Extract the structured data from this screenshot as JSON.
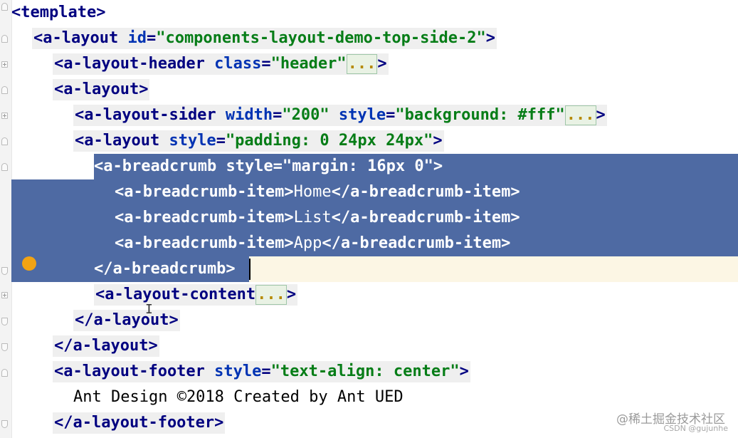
{
  "editor": {
    "lines": [
      {
        "parts": [
          [
            "tag",
            "<template"
          ],
          [
            "tag",
            ">"
          ]
        ]
      },
      {
        "parts": [
          [
            "tag",
            "<a-layout "
          ],
          [
            "attr",
            "id"
          ],
          [
            "tag",
            "="
          ],
          [
            "val",
            "\"components-layout-demo-top-side-2\""
          ],
          [
            "tag",
            ">"
          ]
        ]
      },
      {
        "parts": [
          [
            "tag",
            "<a-layout-header "
          ],
          [
            "attr",
            "class"
          ],
          [
            "tag",
            "="
          ],
          [
            "val",
            "\"header\""
          ],
          [
            "dots",
            "..."
          ],
          [
            "tag",
            ">"
          ]
        ]
      },
      {
        "parts": [
          [
            "tag",
            "<a-layout>"
          ]
        ]
      },
      {
        "parts": [
          [
            "tag",
            "<a-layout-sider "
          ],
          [
            "attr",
            "width"
          ],
          [
            "tag",
            "="
          ],
          [
            "val",
            "\"200\" "
          ],
          [
            "attr",
            "style"
          ],
          [
            "tag",
            "="
          ],
          [
            "val",
            "\"background: #fff\""
          ],
          [
            "dots",
            "..."
          ],
          [
            "tag",
            ">"
          ]
        ]
      },
      {
        "parts": [
          [
            "tag",
            "<a-layout "
          ],
          [
            "attr",
            "style"
          ],
          [
            "tag",
            "="
          ],
          [
            "val",
            "\"padding: 0 24px 24px\""
          ],
          [
            "tag",
            ">"
          ]
        ]
      },
      {
        "parts": [
          [
            "tag",
            "<a-breadcrumb "
          ],
          [
            "attr",
            "style"
          ],
          [
            "tag",
            "="
          ],
          [
            "val",
            "\"margin: 16px 0\""
          ],
          [
            "tag",
            ">"
          ]
        ]
      },
      {
        "parts": [
          [
            "tag",
            "<a-breadcrumb-item>"
          ],
          [
            "txt",
            "Home"
          ],
          [
            "tag",
            "</a-breadcrumb-item>"
          ]
        ]
      },
      {
        "parts": [
          [
            "tag",
            "<a-breadcrumb-item>"
          ],
          [
            "txt",
            "List"
          ],
          [
            "tag",
            "</a-breadcrumb-item>"
          ]
        ]
      },
      {
        "parts": [
          [
            "tag",
            "<a-breadcrumb-item>"
          ],
          [
            "txt",
            "App"
          ],
          [
            "tag",
            "</a-breadcrumb-item>"
          ]
        ]
      },
      {
        "parts": [
          [
            "tag",
            "</a-breadcrumb>"
          ]
        ]
      },
      {
        "parts": [
          [
            "tag",
            "<a-layout-content"
          ],
          [
            "dots",
            "..."
          ],
          [
            "tag",
            ">"
          ]
        ]
      },
      {
        "parts": [
          [
            "tag",
            "</a-layout>"
          ]
        ]
      },
      {
        "parts": [
          [
            "tag",
            "</a-layout>"
          ]
        ]
      },
      {
        "parts": [
          [
            "tag",
            "<a-layout-footer "
          ],
          [
            "attr",
            "style"
          ],
          [
            "tag",
            "="
          ],
          [
            "val",
            "\"text-align: center\""
          ],
          [
            "tag",
            ">"
          ]
        ]
      },
      {
        "parts": [
          [
            "txt",
            "Ant Design ©2018 Created by Ant UED"
          ]
        ]
      },
      {
        "parts": [
          [
            "tag",
            "</a-layout-footer>"
          ]
        ]
      }
    ]
  },
  "watermark": {
    "brand": "@稀土掘金技术社区",
    "credit": "CSDN @gujunhe"
  }
}
